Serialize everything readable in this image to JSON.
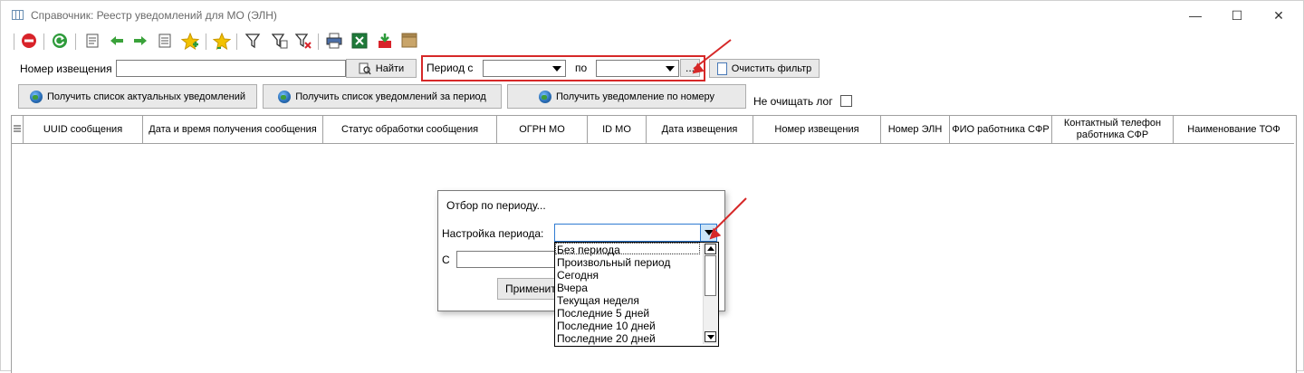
{
  "window": {
    "title": "Справочник: Реестр уведомлений для МО (ЭЛН)",
    "minimize": "—",
    "maximize": "☐",
    "close": "✕"
  },
  "toolbar": {
    "icons": [
      "stop-icon",
      "refresh-icon",
      "properties-icon",
      "arrow-left-icon",
      "arrow-right-icon",
      "document-list-icon",
      "add-star-icon",
      "favorite-icon",
      "filter-icon",
      "filter-edit-icon",
      "filter-clear-icon",
      "print-icon",
      "excel-icon",
      "export-dbf-icon",
      "archive-icon"
    ]
  },
  "filter": {
    "notice_number_label": "Номер извещения",
    "notice_number_value": "",
    "find_button": "Найти",
    "period_from_label": "Период с",
    "period_from_value": "",
    "period_to_label": "по",
    "period_to_value": "",
    "ellipsis_button": "...",
    "clear_filter_button": "Очистить фильтр"
  },
  "actions": {
    "get_actual": "Получить список актуальных уведомлений",
    "get_period": "Получить список уведомлений за период",
    "get_by_number": "Получить уведомление по номеру",
    "keep_log_label": "Не очищать лог"
  },
  "grid": {
    "columns": [
      "UUID сообщения",
      "Дата и время получения сообщения",
      "Статус обработки сообщения",
      "ОГРН МО",
      "ID МО",
      "Дата извещения",
      "Номер извещения",
      "Номер ЭЛН",
      "ФИО работника СФР",
      "Контактный телефон работника СФР",
      "Наименование ТОФ"
    ]
  },
  "dialog": {
    "title": "Отбор по периоду...",
    "period_setting_label": "Настройка периода:",
    "period_setting_value": "",
    "from_label": "С",
    "apply_button": "Применить"
  },
  "dropdown": {
    "options": [
      "Без периода",
      "Произвольный период",
      "Сегодня",
      "Вчера",
      "Текущая неделя",
      "Последние 5 дней",
      "Последние 10 дней",
      "Последние 20 дней"
    ]
  },
  "colors": {
    "highlight": "#d62828",
    "window_border": "#d0d0d0"
  }
}
